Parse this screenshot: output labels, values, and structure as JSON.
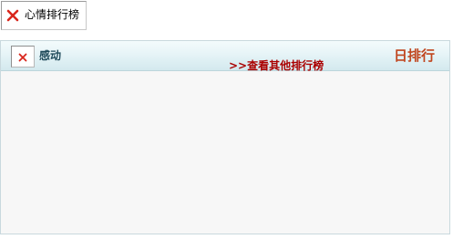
{
  "top_image": {
    "icon": "broken-image-icon",
    "alt_text": "心情排行榜"
  },
  "panel": {
    "header": {
      "icon": "broken-image-icon",
      "title": "感动",
      "more_link": ">>查看其他排行榜",
      "period_label": "日排行"
    }
  },
  "colors": {
    "header_title": "#1f4a5a",
    "link": "#aa0000",
    "period_label": "#c0461f",
    "header_gradient_top": "#f4fbfc",
    "header_gradient_bottom": "#d3e9ee",
    "panel_bg": "#f7f7f7"
  }
}
